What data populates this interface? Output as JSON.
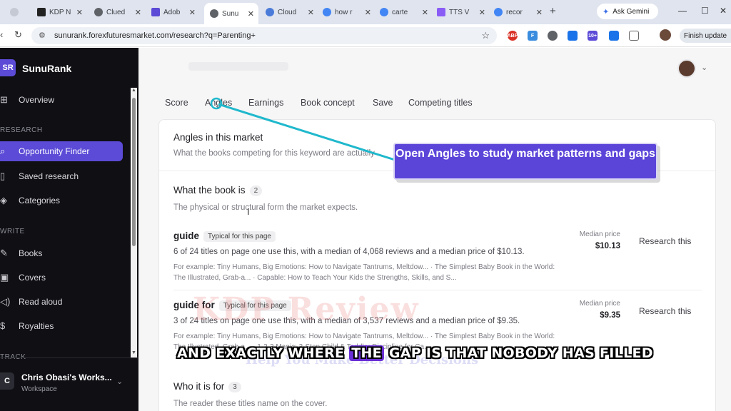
{
  "browser": {
    "tabs": [
      {
        "label": "",
        "color": "#9aa0a6"
      },
      {
        "label": "KDP N",
        "color": "#222222"
      },
      {
        "label": "Clued",
        "color": "#5f6368"
      },
      {
        "label": "Adob",
        "color": "#5b4bd6"
      },
      {
        "label": "Sunu",
        "color": "#5f6368"
      },
      {
        "label": "Cloud",
        "color": "#4a7bd9"
      },
      {
        "label": "how r",
        "color": "#4285f4"
      },
      {
        "label": "carte",
        "color": "#4285f4"
      },
      {
        "label": "TTS V",
        "color": "#8a5cf6"
      },
      {
        "label": "recor",
        "color": "#4285f4"
      }
    ],
    "gemini_label": "Ask Gemini",
    "url": "sunurank.forexfuturesmarket.com/research?q=Parenting+",
    "finish_update_label": "Finish update",
    "ext_labels": [
      "ABP",
      "F",
      "",
      "",
      "10+",
      "",
      ""
    ]
  },
  "sidebar": {
    "badge": "SR",
    "brand": "SunuRank",
    "overview": "Overview",
    "section_research": "RESEARCH",
    "opportunity_finder": "Opportunity Finder",
    "saved_research": "Saved research",
    "categories": "Categories",
    "section_write": "WRITE",
    "books": "Books",
    "covers": "Covers",
    "read_aloud": "Read aloud",
    "royalties": "Royalties",
    "section_track": "TRACK",
    "workspace_badge": "C",
    "workspace_name": "Chris Obasi's Works...",
    "workspace_sub": "Workspace"
  },
  "tabs": [
    "Score",
    "Angles",
    "Earnings",
    "Book concept",
    "Save",
    "Competing titles"
  ],
  "card": {
    "title": "Angles in this market",
    "desc": "What the books competing for this keyword are actually",
    "section1": {
      "title": "What the book is",
      "count": "2",
      "desc": "The physical or structural form the market expects."
    },
    "rows": [
      {
        "title": "guide",
        "badge": "Typical for this page",
        "summary": "6 of 24 titles on page one use this, with a median of 4,068 reviews and a median price of $10.13.",
        "examples": "For example: Tiny Humans, Big Emotions: How to Navigate Tantrums, Meltdow... · The Simplest Baby Book in the World: The Illustrated, Grab-a... · Capable: How to Teach Your Kids the Strengths, Skills, and S...",
        "median_label": "Median price",
        "median_value": "$10.13",
        "action": "Research this"
      },
      {
        "title": "guide for",
        "badge": "Typical for this page",
        "summary": "3 of 24 titles on page one use this, with a median of 3,537 reviews and a median price of $9.35.",
        "examples": "For example: Tiny Humans, Big Emotions: How to Navigate Tantrums, Meltdow... · The Simplest Baby Book in the World: The Illustrated, Grab-a... · 1-2-3 Magic: 3-Step Child & Toddler Discipline for Ca...",
        "median_label": "Median price",
        "median_value": "$9.35",
        "action": "Research this"
      }
    ],
    "section2": {
      "title": "Who it is for",
      "count": "3",
      "desc": "The reader these titles name on the cover."
    }
  },
  "overlay": {
    "callout": "Open Angles to study market patterns and gaps",
    "caption_before": "AND EXACTLY WHERE ",
    "caption_highlight": "THE",
    "caption_after": " GAP IS THAT NOBODY HAS FILLED",
    "watermark_main": "KDP Review",
    "watermark_sub": "Help You Make Better Decisions"
  },
  "colors": {
    "accent": "#5b4bd6",
    "sidebar_bg": "#0f0f14",
    "arrow": "#1fb8cc"
  }
}
